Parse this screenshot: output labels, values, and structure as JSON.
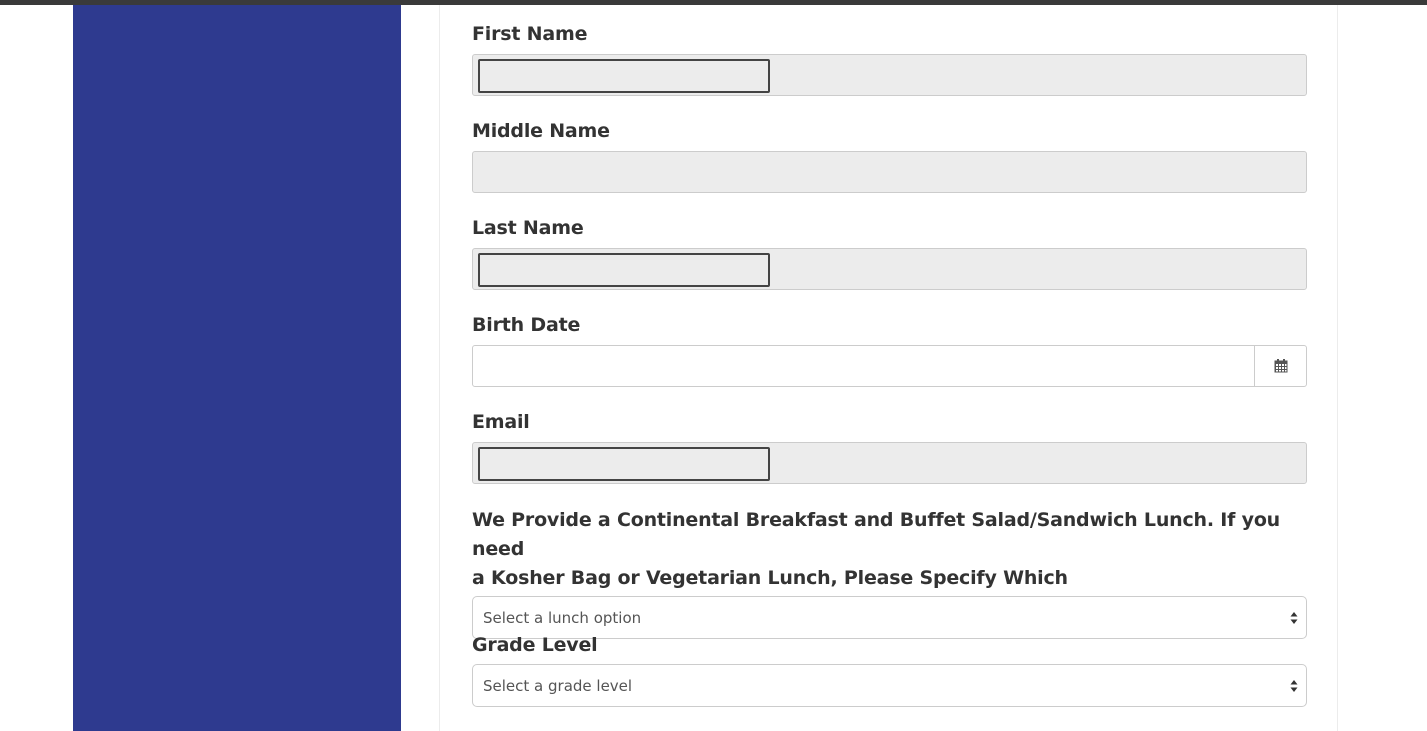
{
  "form": {
    "first_name": {
      "label": "First Name",
      "value": ""
    },
    "middle_name": {
      "label": "Middle Name",
      "value": ""
    },
    "last_name": {
      "label": "Last Name",
      "value": ""
    },
    "birth_date": {
      "label": "Birth Date",
      "value": "",
      "icon": "calendar-icon"
    },
    "email": {
      "label": "Email",
      "value": ""
    },
    "lunch": {
      "label_line1": "We Provide a Continental Breakfast and Buffet Salad/Sandwich Lunch. If you need",
      "label_line2": "a Kosher Bag or Vegetarian Lunch, Please Specify Which",
      "selected": "Select a lunch option"
    },
    "grade": {
      "label": "Grade Level",
      "selected": "Select a grade level"
    }
  },
  "colors": {
    "sidebar": "#2e3a8f",
    "disabled_field": "#ececec",
    "top_rule": "#3a3a3a"
  }
}
